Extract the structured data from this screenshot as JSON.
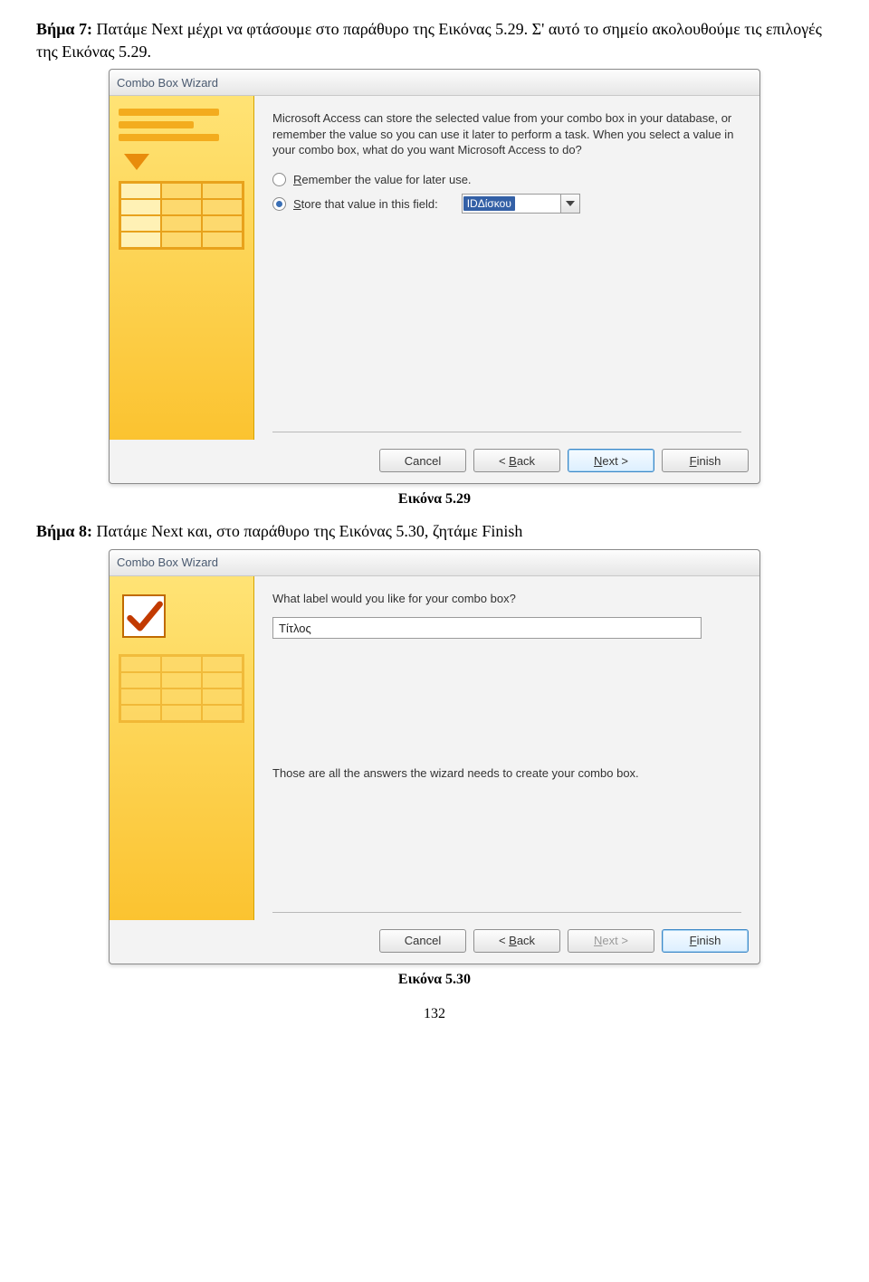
{
  "doc": {
    "step7_label": "Βήμα 7:",
    "step7_text": " Πατάμε Next μέχρι να φτάσουμε στο παράθυρο της Εικόνας 5.29. Σ' αυτό το σημείο ακολουθούμε τις επιλογές της Εικόνας 5.29.",
    "caption1": "Εικόνα 5.29",
    "step8_label": "Βήμα 8:",
    "step8_text": " Πατάμε Next και, στο παράθυρο της Εικόνας 5.30, ζητάμε Finish",
    "caption2": "Εικόνα 5.30",
    "page_number": "132"
  },
  "wiz1": {
    "title": "Combo Box Wizard",
    "desc": "Microsoft Access can store the selected value from your combo box in your database, or remember the value so you can use it later to perform a task. When you select a value in your combo box, what do you want Microsoft Access to do?",
    "opt_remember_pre": "R",
    "opt_remember_post": "emember the value for later use.",
    "opt_store_pre": "S",
    "opt_store_post": "tore that value in this field:",
    "combo_value": "IDΔίσκου",
    "btn_cancel": "Cancel",
    "btn_back_pre": "< ",
    "btn_back_u": "B",
    "btn_back_post": "ack",
    "btn_next_pre": "N",
    "btn_next_post": "ext >",
    "btn_finish_u": "F",
    "btn_finish_post": "inish"
  },
  "wiz2": {
    "title": "Combo Box Wizard",
    "q1": "What label would you like for your combo box?",
    "input_value": "Τίτλος",
    "line2": "Those are all the answers the wizard needs to create your combo box.",
    "btn_cancel": "Cancel",
    "btn_back_pre": "< ",
    "btn_back_u": "B",
    "btn_back_post": "ack",
    "btn_next_pre": "N",
    "btn_next_post": "ext >",
    "btn_finish_u": "F",
    "btn_finish_post": "inish"
  }
}
